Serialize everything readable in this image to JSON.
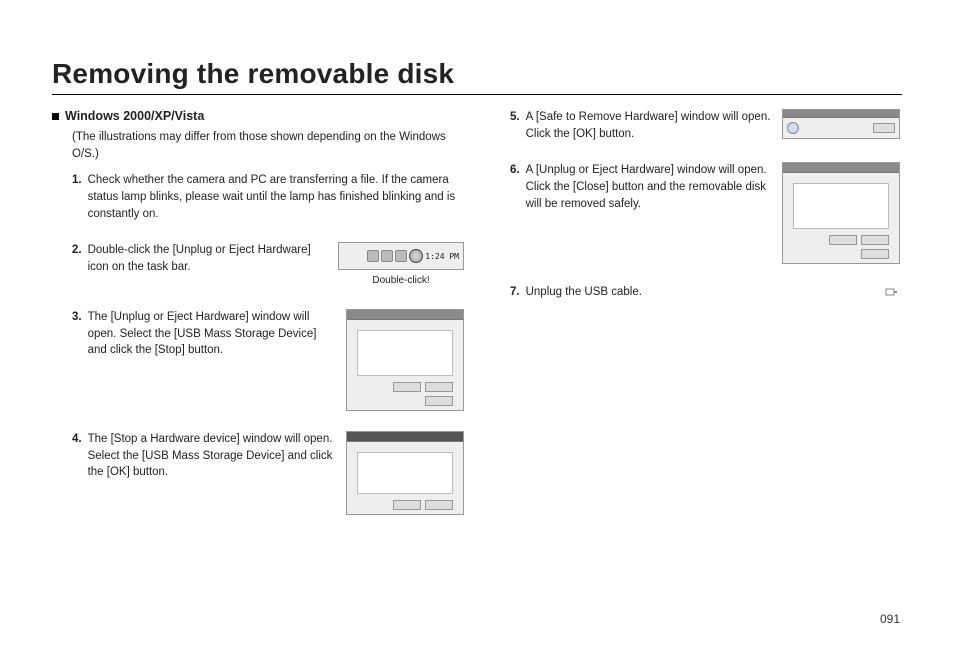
{
  "title": "Removing the removable disk",
  "page_number": "091",
  "section": {
    "heading": "Windows 2000/XP/Vista",
    "intro": "(The illustrations may differ from those shown depending on the Windows O/S.)"
  },
  "steps_left": {
    "s1": {
      "num": "1.",
      "text": "Check whether the camera and PC are transferring a file. If the camera status lamp blinks, please wait until the lamp has finished blinking and is constantly on."
    },
    "s2": {
      "num": "2.",
      "text": "Double-click the [Unplug or Eject Hardware] icon on the task bar.",
      "caption": "Double-click!",
      "clock": "1:24 PM"
    },
    "s3": {
      "num": "3.",
      "text": "The [Unplug or Eject Hardware] window will open. Select the [USB Mass Storage Device] and click the [Stop] button."
    },
    "s4": {
      "num": "4.",
      "text": "The [Stop a Hardware device] window will open. Select the [USB Mass Storage Device] and click the [OK] button."
    }
  },
  "steps_right": {
    "s5": {
      "num": "5.",
      "text": "A [Safe to Remove Hardware] window will open. Click the [OK] button."
    },
    "s6": {
      "num": "6.",
      "text": "A [Unplug or Eject Hardware] window will open. Click the [Close] button and the removable disk will be removed safely."
    },
    "s7": {
      "num": "7.",
      "text": "Unplug the USB cable."
    }
  }
}
